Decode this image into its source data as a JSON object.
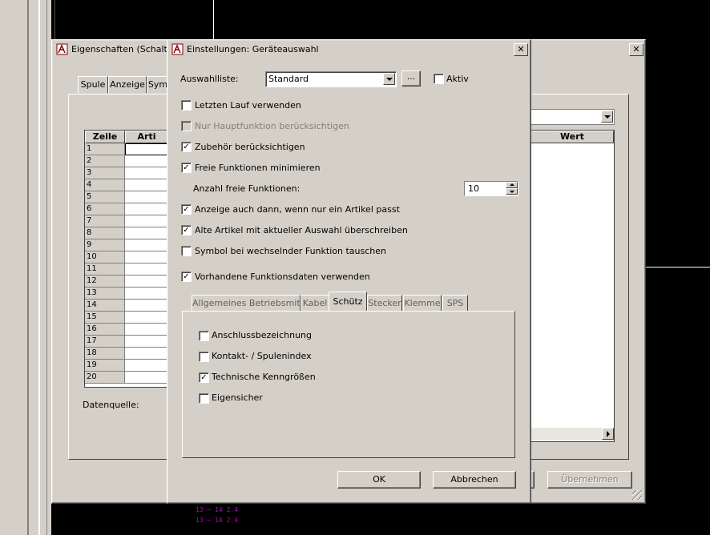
{
  "background": {
    "canvas_color": "#000000",
    "schematic_texts": [
      "13",
      "14",
      "2.4",
      "13",
      "14",
      "2.4"
    ]
  },
  "back_dialog": {
    "title": "Eigenschaften (Schalt",
    "tabs": [
      "Spule",
      "Anzeige",
      "Sym"
    ],
    "grid": {
      "col_headers": [
        "Zeile",
        "Arti"
      ],
      "rows": [
        "1",
        "2",
        "3",
        "4",
        "5",
        "6",
        "7",
        "8",
        "9",
        "10",
        "11",
        "12",
        "13",
        "14",
        "15",
        "16",
        "17",
        "18",
        "19",
        "20"
      ]
    },
    "datasource_label": "Datenquelle:",
    "right_grid_header": "Wert",
    "apply_button": "Übernehmen"
  },
  "dialog": {
    "title": "Einstellungen: Geräteauswahl",
    "close_icon": "close-icon",
    "selection_label": "Auswahlliste:",
    "selection_value": "Standard",
    "browse_button": "...",
    "active_label": "Aktiv",
    "options": [
      {
        "label": "Letzten Lauf verwenden",
        "checked": false,
        "disabled": false
      },
      {
        "label": "Nur Hauptfunktion berücksichtigen",
        "checked": false,
        "disabled": true
      },
      {
        "label": "Zubehör berücksichtigen",
        "checked": true,
        "disabled": false
      },
      {
        "label": "Freie Funktionen minimieren",
        "checked": true,
        "disabled": false
      }
    ],
    "free_functions_label": "Anzahl freie Funktionen:",
    "free_functions_value": "10",
    "options2": [
      {
        "label": "Anzeige auch dann, wenn nur ein Artikel passt",
        "checked": true
      },
      {
        "label": "Alte Artikel mit aktueller Auswahl überschreiben",
        "checked": true
      },
      {
        "label": "Symbol bei wechselnder Funktion tauschen",
        "checked": false
      }
    ],
    "existing_data_label": "Vorhandene Funktionsdaten verwenden",
    "existing_data_checked": true,
    "tabs": [
      "Allgemeines Betriebsmittel",
      "Kabel",
      "Schütz",
      "Stecker",
      "Klemme",
      "SPS"
    ],
    "active_tab": "Schütz",
    "tab_options": [
      {
        "label": "Anschlussbezeichnung",
        "checked": false
      },
      {
        "label": "Kontakt- / Spulenindex",
        "checked": false
      },
      {
        "label": "Technische Kenngrößen",
        "checked": true
      },
      {
        "label": "Eigensicher",
        "checked": false
      }
    ],
    "ok_button": "OK",
    "cancel_button": "Abbrechen"
  }
}
